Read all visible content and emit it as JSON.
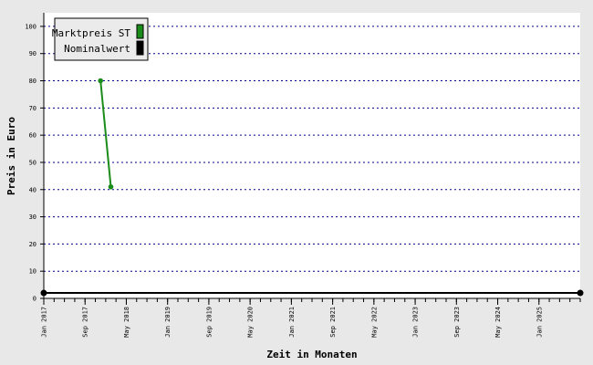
{
  "chart_data": {
    "type": "line",
    "xlabel": "Zeit in Monaten",
    "ylabel": "Preis in Euro",
    "ylim": [
      0,
      105
    ],
    "yticks": [
      0,
      10,
      20,
      30,
      40,
      50,
      60,
      70,
      80,
      90,
      100
    ],
    "xlim": [
      "2017-01",
      "2025-09"
    ],
    "xticks": [
      "Jan 2017",
      "Sep 2017",
      "May 2018",
      "Jan 2019",
      "Sep 2019",
      "May 2020",
      "Jan 2021",
      "Sep 2021",
      "May 2022",
      "Jan 2023",
      "Sep 2023",
      "May 2024",
      "Jan 2025"
    ],
    "grid": "horizontal dotted",
    "legend_position": "top-left",
    "series": [
      {
        "name": "Marktpreis ST",
        "color": "#1a8c1a",
        "points": [
          {
            "x": "2017-12",
            "y": 80
          },
          {
            "x": "2018-02",
            "y": 41
          }
        ]
      },
      {
        "name": "Nominalwert",
        "color": "#000000",
        "points": [
          {
            "x": "2017-01",
            "y": 2
          },
          {
            "x": "2025-09",
            "y": 2
          }
        ]
      }
    ]
  },
  "colors": {
    "background": "#e8e8e8",
    "plot": "#ffffff",
    "grid": "#00008b"
  }
}
